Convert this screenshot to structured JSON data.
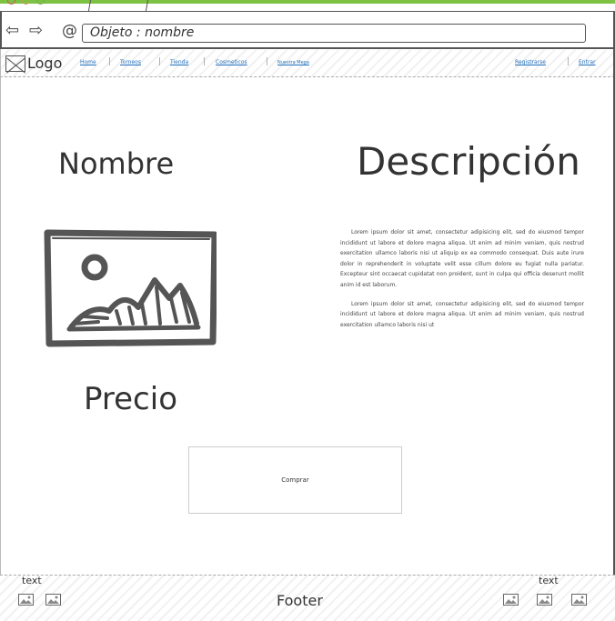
{
  "browser": {
    "url": "Objeto : nombre",
    "back_icon": "back-arrow-icon",
    "forward_icon": "forward-arrow-icon",
    "at_icon": "at-sign-icon"
  },
  "header": {
    "logo": "Logo",
    "nav": [
      "Home",
      "Torneos",
      "Tienda",
      "Cosmeticos",
      "Nuestra Mega"
    ],
    "register": "Registrarse",
    "login": "Entrar"
  },
  "main": {
    "name": "Nombre",
    "description_title": "Descripción",
    "price": "Precio",
    "paragraphs": [
      "Lorem ipsum dolor sit amet, consectetur adipisicing elit, sed do eiusmod tempor incididunt ut labore et dolore magna aliqua. Ut enim ad minim veniam, quis nostrud exercitation ullamco laboris nisi ut aliquip ex ea commodo consequat. Duis aute irure dolor in reprehenderit in voluptate velit esse cillum dolore eu fugiat nulla pariatur. Excepteur sint occaecat cupidatat non proident, sunt in culpa qui officia deserunt mollit anim id est laborum.",
      "Lorem ipsum dolor sit amet, consectetur adipisicing elit, sed do eiusmod tempor incididunt ut labore et dolore magna aliqua. Ut enim ad minim veniam, quis nostrud exercitation ullamco laboris nisi ut"
    ],
    "buy_button": "Comprar"
  },
  "footer": {
    "left_text": "text",
    "title": "Footer",
    "right_text": "text"
  },
  "colors": {
    "accent_green": "#7dc242",
    "link_blue": "#1e6ebd"
  }
}
